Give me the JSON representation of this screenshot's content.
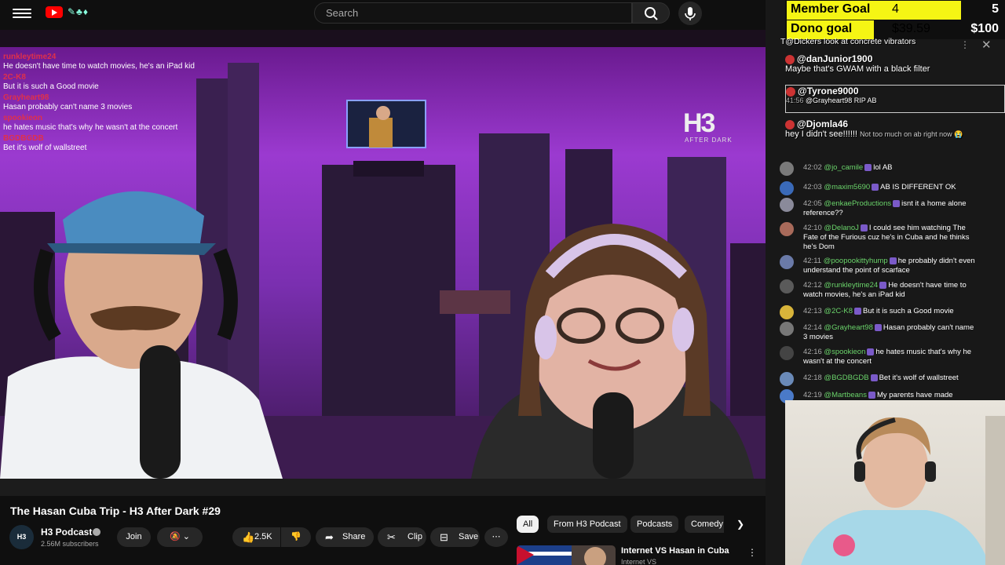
{
  "topbar": {
    "search_placeholder": "Search"
  },
  "overlay_chat": [
    {
      "user": "runkleytime24",
      "msg": "He doesn't have time to watch movies, he's an iPad kid"
    },
    {
      "user": "2C-K8",
      "msg": "But it is such a Good movie"
    },
    {
      "user": "Grayheart98",
      "msg": "Hasan probably can't name 3 movies"
    },
    {
      "user": "spookieon",
      "msg": "he hates music that's why he wasn't at the concert"
    },
    {
      "user": "BGDBGDB",
      "msg": "Bet it's wolf of wallstreet"
    }
  ],
  "stream_logo": {
    "main": "H3",
    "sub": "AFTER DARK"
  },
  "video": {
    "title": "The Hasan Cuba Trip - H3 After Dark #29",
    "channel": "H3 Podcast",
    "channel_avatar_text": "H3",
    "subscribers": "2.56M subscribers",
    "join_label": "Join",
    "likes": "2.5K",
    "share_label": "Share",
    "clip_label": "Clip",
    "save_label": "Save"
  },
  "chips": [
    "All",
    "From H3 Podcast",
    "Podcasts",
    "Comedy"
  ],
  "recommendation": {
    "title": "Internet VS Hasan in Cuba",
    "sub": "Internet VS"
  },
  "goals": [
    {
      "label": "Member Goal",
      "value": "4",
      "target": "5",
      "fill_fraction": 0.8
    },
    {
      "label": "Dono goal",
      "value": "$39.59",
      "target": "$100",
      "fill_fraction": 0.4
    }
  ],
  "chat_header_text": "T@Dickers look at concrete vibrators",
  "bubbles": [
    {
      "name": "@danJunior1900",
      "msg": "Maybe that's GWAM with a black filter"
    },
    {
      "name": "@Tyrone9000",
      "msg": "@Grayheart98 RIP AB",
      "time": "41:56"
    },
    {
      "name": "@Djomla46",
      "msg": "hey I didn't see!!!!!!",
      "extra": "Not too much on ab right now 😭"
    }
  ],
  "chat_messages": [
    {
      "time": "42:02",
      "author": "@jo_camile",
      "text": "lol AB"
    },
    {
      "time": "42:03",
      "author": "@maxim5690",
      "text": "AB IS DIFFERENT OK"
    },
    {
      "time": "42:05",
      "author": "@enkaeProductions",
      "text": "isnt it a home alone reference??"
    },
    {
      "time": "42:10",
      "author": "@DelanoJ",
      "text": "I could see him watching The Fate of the Furious cuz he's in Cuba and he thinks he's Dom"
    },
    {
      "time": "42:11",
      "author": "@poopookittyhump",
      "text": "he probably didn't even understand the point of scarface"
    },
    {
      "time": "42:12",
      "author": "@runkleytime24",
      "text": "He doesn't have time to watch movies, he's an iPad kid"
    },
    {
      "time": "42:13",
      "author": "@2C-K8",
      "text": "But it is such a Good movie"
    },
    {
      "time": "42:14",
      "author": "@Grayheart98",
      "text": "Hasan probably can't name 3 movies"
    },
    {
      "time": "42:16",
      "author": "@spookieon",
      "text": "he hates music that's why he wasn't at the concert"
    },
    {
      "time": "42:18",
      "author": "@BGDBGDB",
      "text": "Bet it's wolf of wallstreet"
    },
    {
      "time": "42:19",
      "author": "@Martbeans",
      "text": "My parents have made"
    }
  ]
}
